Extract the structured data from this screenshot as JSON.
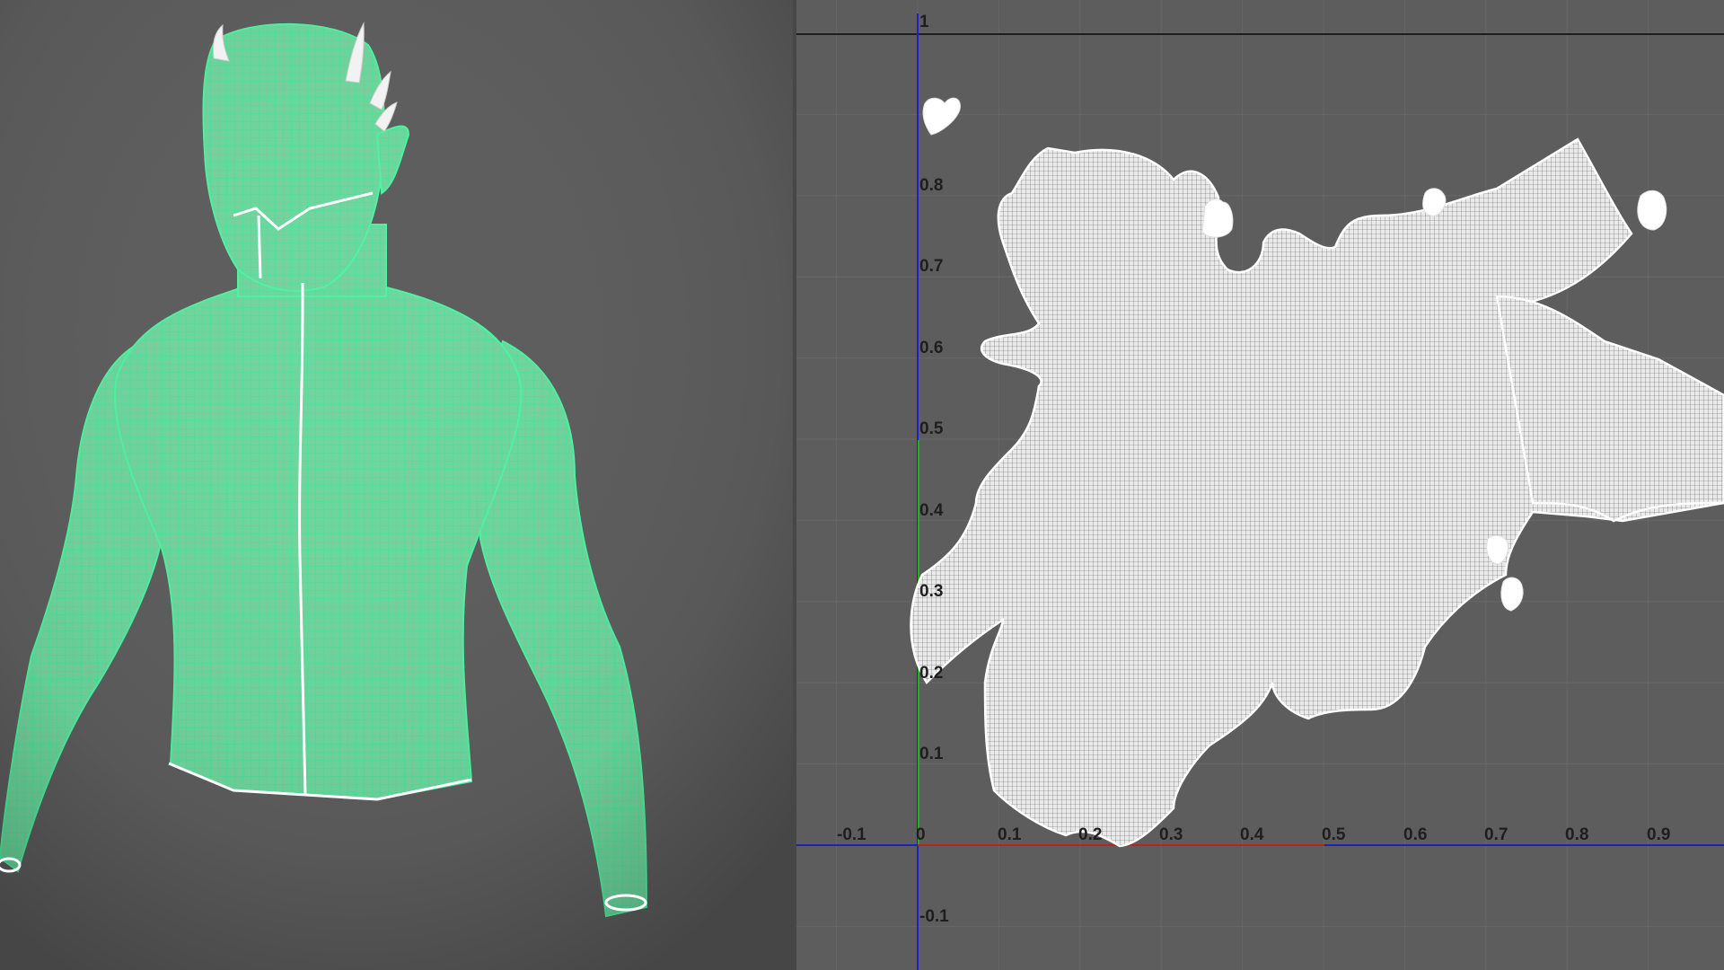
{
  "uv_editor": {
    "u_labels": [
      "-0.1",
      "0",
      "0.1",
      "0.2",
      "0.3",
      "0.4",
      "0.5",
      "0.6",
      "0.7",
      "0.8",
      "0.9"
    ],
    "v_labels": [
      "1",
      "0.8",
      "0.7",
      "0.6",
      "0.5",
      "0.4",
      "0.3",
      "0.2",
      "0.1",
      "-0.1"
    ],
    "colors": {
      "background": "#5d5d5d",
      "grid": "#686868",
      "u_axis": "#c02020",
      "v_axis": "#2020c0",
      "v_axis_lower": "#20b020",
      "uv_shells": "#ffffff",
      "tick_label": "#1e1e1e"
    }
  },
  "viewport_3d": {
    "subject": "creature torso wireframe",
    "colors": {
      "mesh_fill": "#7fd6a8",
      "mesh_wire": "#4df3a0",
      "seam": "#ffffff",
      "background": "#5d5d5d"
    }
  }
}
